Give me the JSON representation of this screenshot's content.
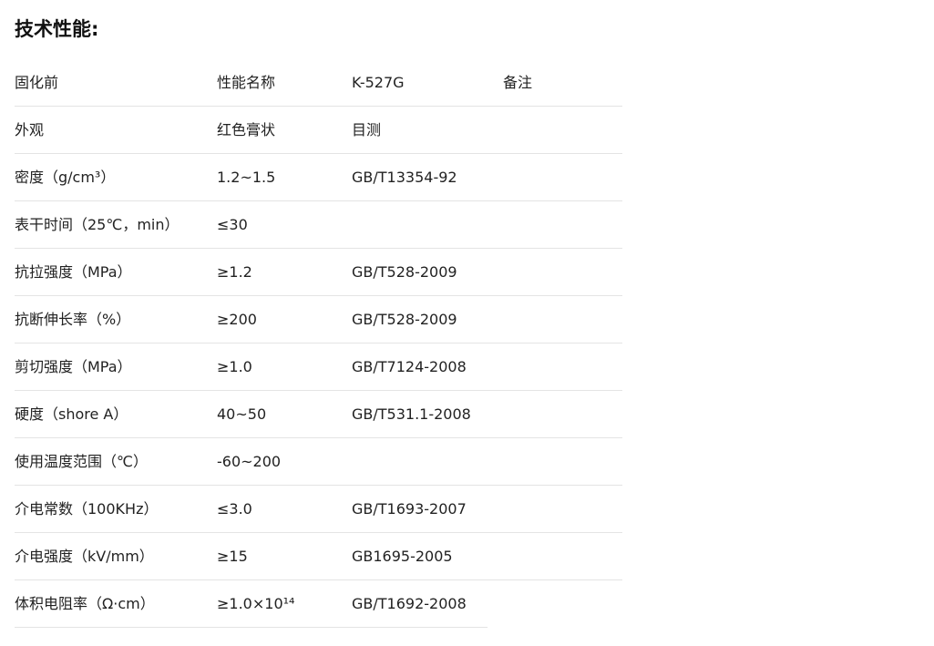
{
  "title": "技术性能:",
  "table": {
    "headers": [
      "固化前",
      "性能名称",
      "K-527G",
      "备注"
    ],
    "rows": [
      [
        "外观",
        "红色膏状",
        "目测",
        ""
      ],
      [
        "密度（g/cm³）",
        "1.2~1.5",
        "GB/T13354-92",
        ""
      ],
      [
        "表干时间（25℃，min）",
        "≤30",
        "",
        ""
      ],
      [
        "抗拉强度（MPa）",
        "≥1.2",
        "GB/T528-2009",
        ""
      ],
      [
        "抗断伸长率（%）",
        "≥200",
        "GB/T528-2009",
        ""
      ],
      [
        "剪切强度（MPa）",
        "≥1.0",
        "GB/T7124-2008",
        ""
      ],
      [
        "硬度（shore A）",
        "40~50",
        "GB/T531.1-2008",
        ""
      ],
      [
        "使用温度范围（℃）",
        "-60~200",
        "",
        ""
      ],
      [
        "介电常数（100KHz）",
        "≤3.0",
        "GB/T1693-2007",
        ""
      ],
      [
        "介电强度（kV/mm）",
        "≥15",
        "GB1695-2005",
        ""
      ],
      [
        "体积电阻率（Ω·cm）",
        "≥1.0×10¹⁴",
        "GB/T1692-2008",
        ""
      ]
    ]
  }
}
